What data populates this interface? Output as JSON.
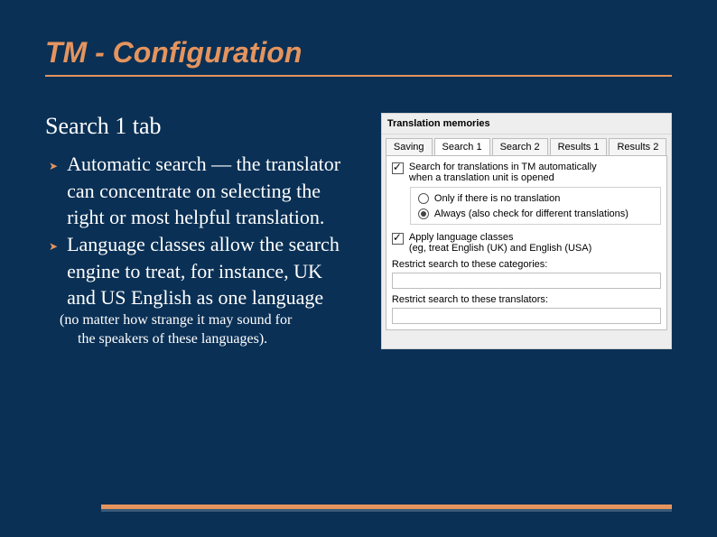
{
  "title": "TM - Configuration",
  "subtitle": "Search 1 tab",
  "bullets": [
    "Automatic search — the translator can concentrate on selecting the right or most helpful translation.",
    "Language classes allow the search engine to treat, for instance, UK and US English as one language"
  ],
  "note_line1": "(no matter how strange it may sound for",
  "note_line2": "the speakers of these languages).",
  "dialog": {
    "header": "Translation memories",
    "tabs": [
      "Saving",
      "Search 1",
      "Search 2",
      "Results 1",
      "Results 2"
    ],
    "option1_line1": "Search for translations in TM automatically",
    "option1_line2": "when a translation unit is opened",
    "radio1": "Only if there is no translation",
    "radio2": "Always (also check for different translations)",
    "option2_line1": "Apply language classes",
    "option2_line2": "(eg, treat English (UK) and English (USA)",
    "restrict_cat": "Restrict search to these categories:",
    "restrict_tr": "Restrict search to these translators:"
  }
}
